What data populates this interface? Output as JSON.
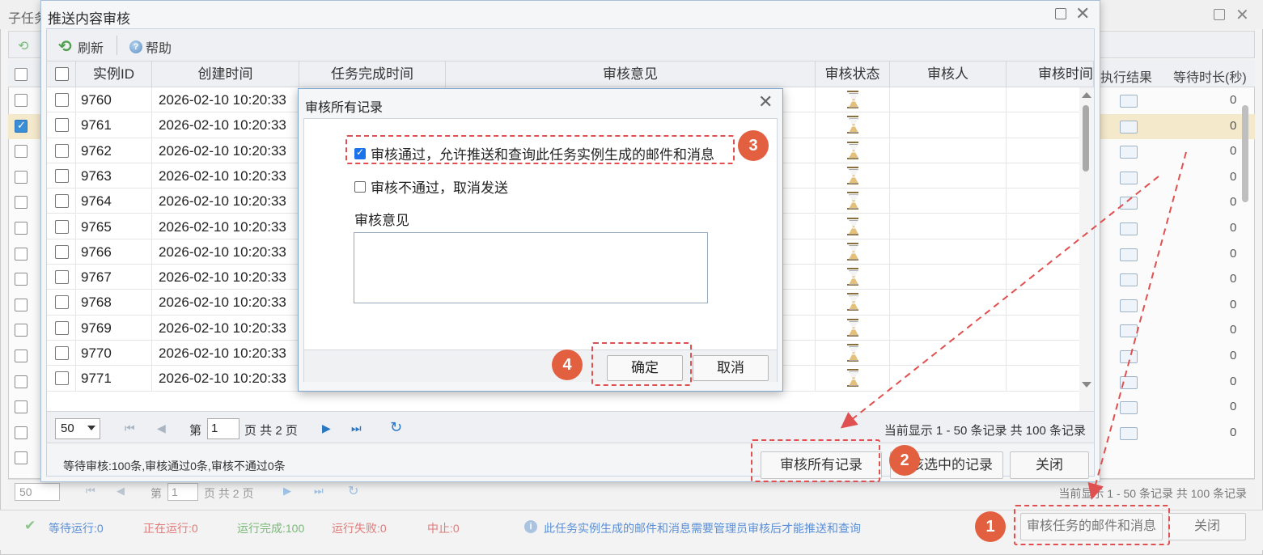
{
  "bg_window": {
    "title": "子任务",
    "status": {
      "waiting": "等待运行:0",
      "running": "正在运行:0",
      "done": "运行完成:100",
      "failed": "运行失败:0",
      "stopped": "中止:0",
      "notice": "此任务实例生成的邮件和消息需要管理员审核后才能推送和查询"
    },
    "headers": {
      "exec_result": "执行结果",
      "wait_time": "等待时长(秒)"
    },
    "zero": "0",
    "pager": {
      "page_size": "50",
      "page_prefix": "第",
      "page_value": "1",
      "page_suffix": "页 共 2 页",
      "info": "当前显示 1 - 50 条记录 共 100 条记录"
    },
    "btn_review": "审核任务的邮件和消息",
    "btn_close": "关闭"
  },
  "main_window": {
    "title": "推送内容审核",
    "toolbar": {
      "refresh": "刷新",
      "help": "帮助"
    },
    "columns": {
      "id": "实例ID",
      "created": "创建时间",
      "completed": "任务完成时间",
      "opinion": "审核意见",
      "status": "审核状态",
      "reviewer": "审核人",
      "review_time": "审核时间"
    },
    "rows": [
      {
        "id": "9760",
        "created": "2026-02-10 10:20:33"
      },
      {
        "id": "9761",
        "created": "2026-02-10 10:20:33"
      },
      {
        "id": "9762",
        "created": "2026-02-10 10:20:33"
      },
      {
        "id": "9763",
        "created": "2026-02-10 10:20:33"
      },
      {
        "id": "9764",
        "created": "2026-02-10 10:20:33"
      },
      {
        "id": "9765",
        "created": "2026-02-10 10:20:33"
      },
      {
        "id": "9766",
        "created": "2026-02-10 10:20:33"
      },
      {
        "id": "9767",
        "created": "2026-02-10 10:20:33"
      },
      {
        "id": "9768",
        "created": "2026-02-10 10:20:33"
      },
      {
        "id": "9769",
        "created": "2026-02-10 10:20:33"
      },
      {
        "id": "9770",
        "created": "2026-02-10 10:20:33"
      },
      {
        "id": "9771",
        "created": "2026-02-10 10:20:33"
      }
    ],
    "pager": {
      "page_size": "50",
      "page_prefix": "第",
      "page_value": "1",
      "page_suffix": "页 共 2 页",
      "info": "当前显示 1 - 50 条记录 共 100 条记录"
    },
    "footer_text": "等待审核:100条,审核通过0条,审核不通过0条",
    "btn_review_all": "审核所有记录",
    "btn_review_selected": "审核选中的记录",
    "btn_close": "关闭"
  },
  "modal": {
    "title": "审核所有记录",
    "opt_pass": "审核通过，允许推送和查询此任务实例生成的邮件和消息",
    "opt_fail": "审核不通过，取消发送",
    "opinion_label": "审核意见",
    "btn_ok": "确定",
    "btn_cancel": "取消"
  },
  "badges": [
    "1",
    "2",
    "3",
    "4"
  ],
  "colors": {
    "annotation": "#e05050",
    "badge": "#e2603f",
    "selected_row": "#f5e9cc"
  }
}
